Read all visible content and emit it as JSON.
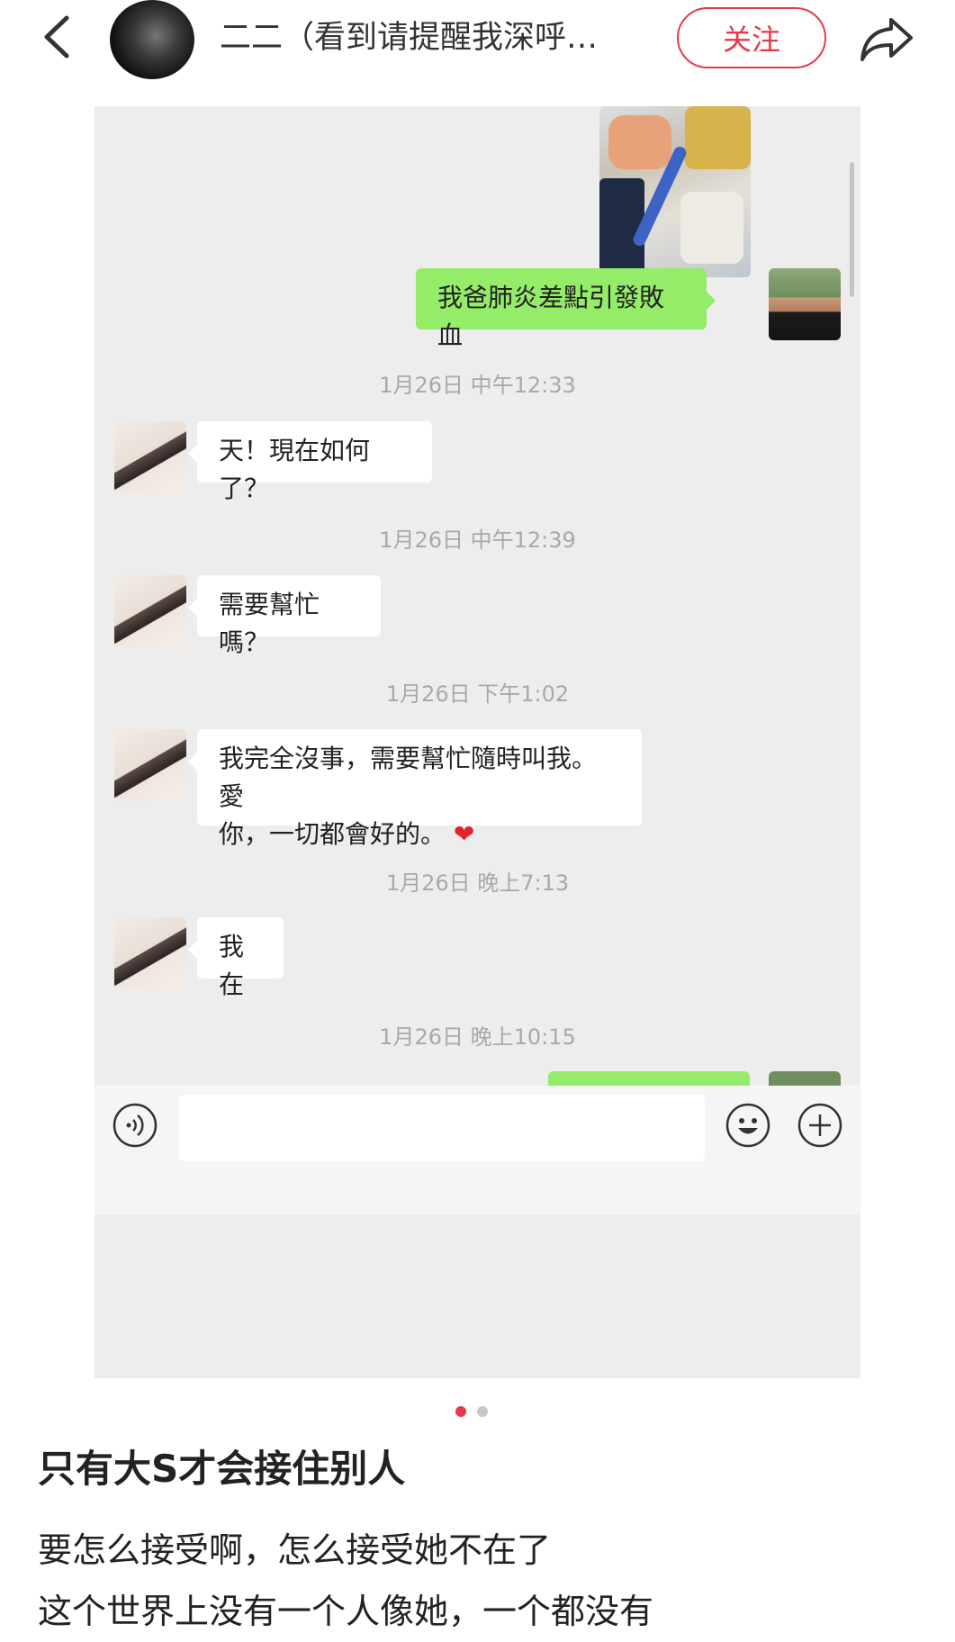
{
  "header": {
    "back_icon": "chevron-left-icon",
    "user_name": "二二（看到请提醒我深呼…",
    "follow_label": "关注",
    "share_icon": "share-arrow-icon"
  },
  "chat": {
    "messages": [
      {
        "side": "right",
        "type": "image",
        "content": "photo"
      },
      {
        "side": "right",
        "type": "text",
        "text": "我爸肺炎差點引發敗血"
      },
      {
        "type": "timestamp",
        "text": "1月26日 中午12:33"
      },
      {
        "side": "left",
        "type": "text",
        "text": "天！現在如何了？"
      },
      {
        "type": "timestamp",
        "text": "1月26日 中午12:39"
      },
      {
        "side": "left",
        "type": "text",
        "text": "需要幫忙嗎？"
      },
      {
        "type": "timestamp",
        "text": "1月26日 下午1:02"
      },
      {
        "side": "left",
        "type": "text",
        "line1": "我完全沒事，需要幫忙隨時叫我。愛",
        "line2": "你，一切都會好的。",
        "emoji": "❤"
      },
      {
        "type": "timestamp",
        "text": "1月26日 晚上7:13"
      },
      {
        "side": "left",
        "type": "text",
        "text": "我在"
      },
      {
        "type": "timestamp",
        "text": "1月26日 晚上10:15"
      }
    ],
    "input_bar": {
      "voice_icon": "voice-icon",
      "emoji_icon": "emoji-icon",
      "plus_icon": "plus-icon"
    }
  },
  "pagination": {
    "current": 1,
    "total": 2
  },
  "post": {
    "title": "只有大S才会接住别人",
    "body": [
      "要怎么接受啊，怎么接受她不在了",
      "这个世界上没有一个人像她，一个都没有"
    ]
  },
  "colors": {
    "accent": "#e5394a",
    "chat_bg": "#ededed",
    "bubble_green": "#95ec69",
    "bubble_white": "#ffffff"
  }
}
